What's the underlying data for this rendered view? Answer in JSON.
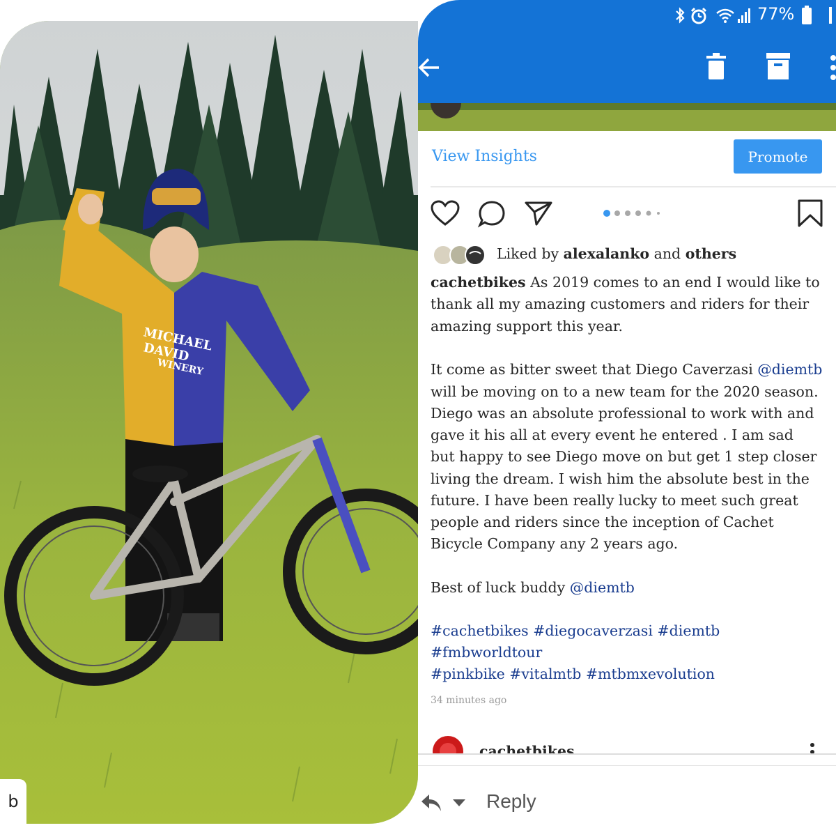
{
  "status_bar": {
    "battery": "77%",
    "icons": [
      "bluetooth-icon",
      "alarm-icon",
      "wifi-icon",
      "signal-icon",
      "battery-icon"
    ]
  },
  "toolbar": {
    "icons": [
      "back-arrow-icon",
      "trash-icon",
      "archive-icon",
      "more-vertical-icon"
    ]
  },
  "post": {
    "view_insights": "View Insights",
    "promote": "Promote",
    "liked_by_prefix": "Liked by",
    "liked_by_user": "alexalanko",
    "liked_by_and": "and",
    "liked_by_others": "others",
    "username": "cachetbikes",
    "caption_lines": [
      "As 2019 comes to an end I would like to",
      "thank all my amazing customers and riders for their",
      "amazing support this year."
    ],
    "p2_line1_pre": "It come as bitter sweet that Diego Caverzasi",
    "p2_mention": "@diemtb",
    "p2_lines": [
      "will be moving on to a new team for the 2020 season.",
      "Diego was an absolute professional to work with and",
      "gave it his all at every event he entered . I am sad",
      "but happy to see Diego move on but get 1 step closer",
      "living the dream.  I wish him the absolute best in the",
      "future.  I have been really lucky to meet such great",
      "people and riders since the inception of Cachet",
      "Bicycle Company any 2 years ago."
    ],
    "p3_pre": "Best of luck buddy",
    "p3_mention": "@diemtb",
    "hashtags": [
      "#cachetbikes #diegocaverzasi #diemtb",
      "#fmbworldtour",
      "#pinkbike #vitalmtb #mtbmxevolution"
    ],
    "time_ago": "34 minutes ago",
    "next_post_user": "cachetbikes"
  },
  "reply_bar": {
    "reply_label": "Reply"
  },
  "photo": {
    "jersey_text": [
      "MICHAEL",
      "DAVID",
      "WINERY"
    ],
    "corner_glyph": "b"
  },
  "colors": {
    "status_bar": "#1473d6",
    "link_blue": "#3897f0",
    "mention_blue": "#1a3d8f"
  }
}
